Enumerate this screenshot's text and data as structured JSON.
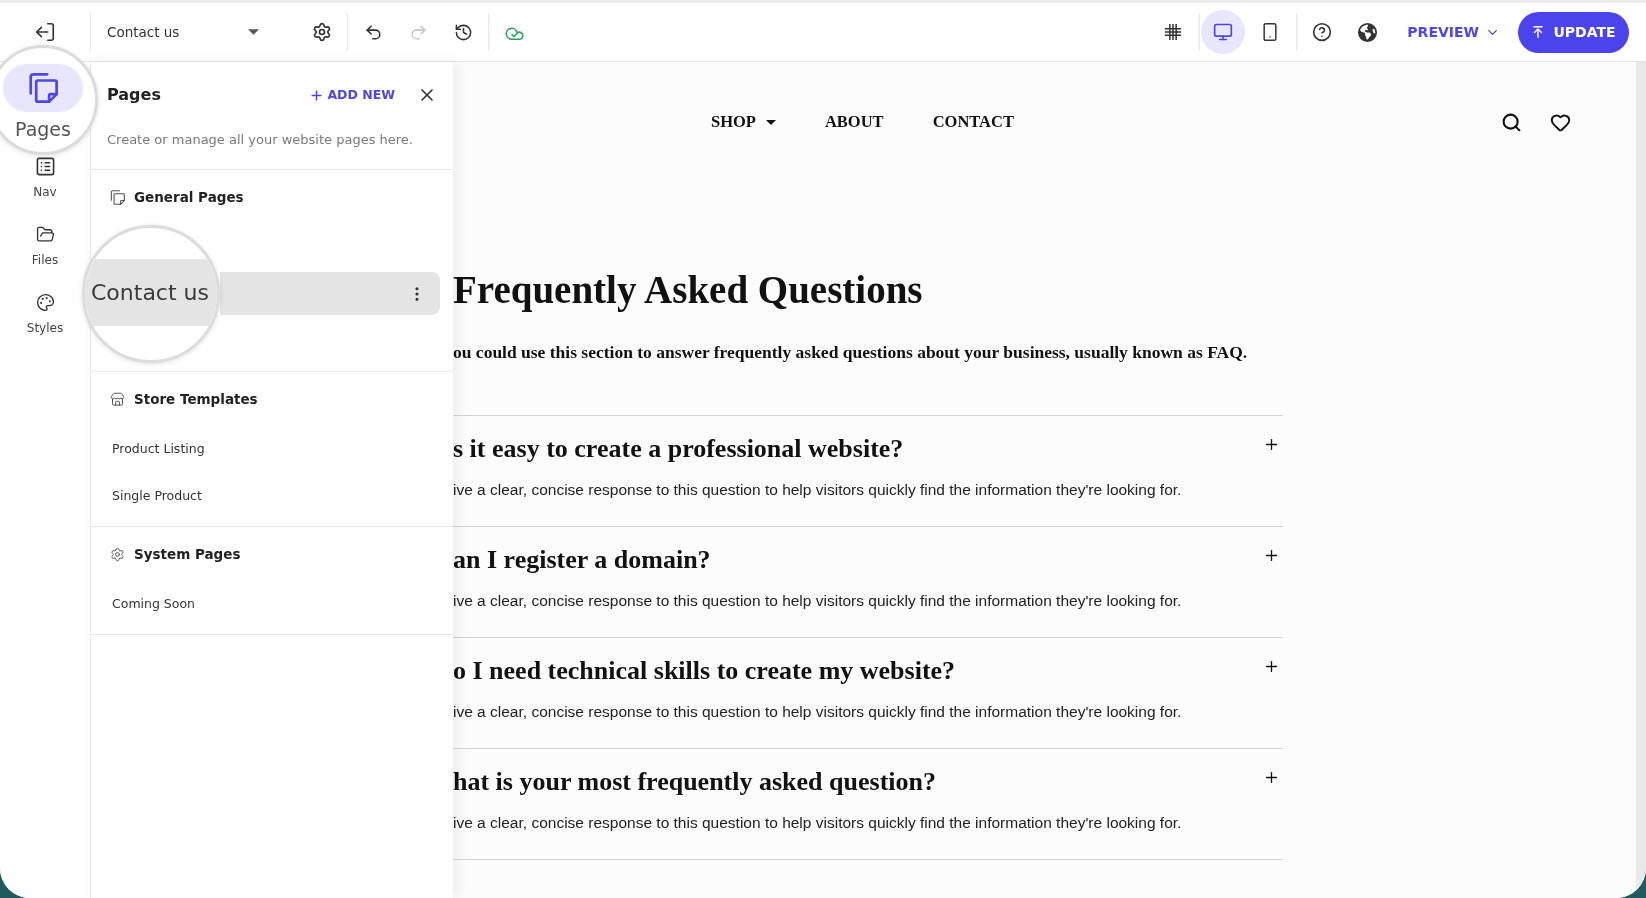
{
  "toolbar": {
    "page_select": {
      "value": "Contact us"
    },
    "history": [
      {
        "kind": "undo",
        "disabled": false
      },
      {
        "kind": "redo",
        "disabled": true
      },
      {
        "kind": "restore",
        "disabled": false
      }
    ],
    "devices": [
      {
        "kind": "desktop",
        "selected": true
      },
      {
        "kind": "mobile",
        "selected": false
      }
    ],
    "preview": "PREVIEW",
    "update": "UPDATE"
  },
  "rail": [
    {
      "kind": "pages",
      "label": "Pages",
      "selected": true,
      "magnified": true
    },
    {
      "kind": "nav",
      "label": "Nav",
      "selected": false,
      "magnified": false
    },
    {
      "kind": "files",
      "label": "Files",
      "selected": false,
      "magnified": false
    },
    {
      "kind": "styles",
      "label": "Styles",
      "selected": false,
      "magnified": false
    }
  ],
  "pages_panel": {
    "title": "Pages",
    "add_new": "ADD NEW",
    "description": "Create or manage all your website pages here.",
    "sections": [
      {
        "kind": "general",
        "title": "General Pages",
        "items": [
          {
            "label": "Contact us",
            "selected": true,
            "magnified": true
          }
        ]
      },
      {
        "kind": "store",
        "title": "Store Templates",
        "items": [
          {
            "label": "Product Listing",
            "selected": false,
            "magnified": false
          },
          {
            "label": "Single Product",
            "selected": false,
            "magnified": false
          }
        ]
      },
      {
        "kind": "system",
        "title": "System Pages",
        "items": [
          {
            "label": "Coming Soon",
            "selected": false,
            "magnified": false
          }
        ]
      }
    ]
  },
  "site": {
    "nav": [
      {
        "label": "SHOP",
        "dropdown": true
      },
      {
        "label": "ABOUT",
        "dropdown": false
      },
      {
        "label": "CONTACT",
        "dropdown": false
      }
    ],
    "heading": "Frequently Asked Questions",
    "intro": "ou could use this section to answer frequently asked questions about your business, usually known as FAQ.",
    "faq": [
      {
        "question": "s it easy to create a professional website?",
        "answer": "ive a clear, concise response to this question to help visitors quickly find the information they're looking for."
      },
      {
        "question": "an I register a domain?",
        "answer": "ive a clear, concise response to this question to help visitors quickly find the information they're looking for."
      },
      {
        "question": "o I need technical skills to create my website?",
        "answer": "ive a clear, concise response to this question to help visitors quickly find the information they're looking for."
      },
      {
        "question": "hat is your most frequently asked question?",
        "answer": "ive a clear, concise response to this question to help visitors quickly find the information they're looking for."
      }
    ]
  }
}
